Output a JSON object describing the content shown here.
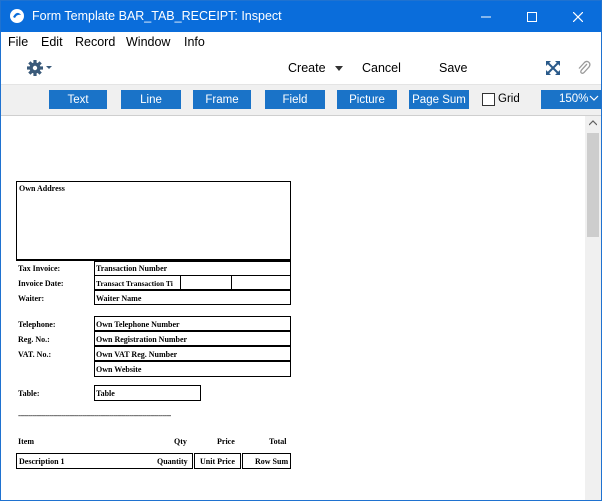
{
  "window": {
    "title": "Form Template BAR_TAB_RECEIPT: Inspect"
  },
  "menu": [
    "File",
    "Edit",
    "Record",
    "Window",
    "Info"
  ],
  "toolbar": {
    "create_label": "Create",
    "cancel_label": "Cancel",
    "save_label": "Save"
  },
  "fieldbar": {
    "buttons": [
      "Text",
      "Line",
      "Frame",
      "Field",
      "Picture",
      "Page Sum"
    ],
    "grid_label": "Grid",
    "grid_checked": false,
    "zoom": "150%"
  },
  "form": {
    "own_address": "Own Address",
    "tax_invoice_label": "Tax Invoice:",
    "transaction_number": "Transaction Number",
    "invoice_date_label": "Invoice Date:",
    "transact_date": "Transact Transaction Ti",
    "waiter_label": "Waiter:",
    "waiter_name": "Waiter Name",
    "telephone_label": "Telephone:",
    "own_telephone": "Own Telephone Number",
    "reg_no_label": "Reg. No.:",
    "own_registration": "Own Registration Number",
    "vat_no_label": "VAT. No.:",
    "own_vat": "Own VAT Reg. Number",
    "own_website": "Own Website",
    "table_label": "Table:",
    "table_field": "Table",
    "separator": "--------------------------------------------------------------------------",
    "item_header": "Item",
    "qty_header": "Qty",
    "price_header": "Price",
    "total_header": "Total",
    "description_field": "Description 1",
    "quantity_field": "Quantity",
    "unit_price_field": "Unit Price",
    "row_sum_field": "Row Sum"
  }
}
